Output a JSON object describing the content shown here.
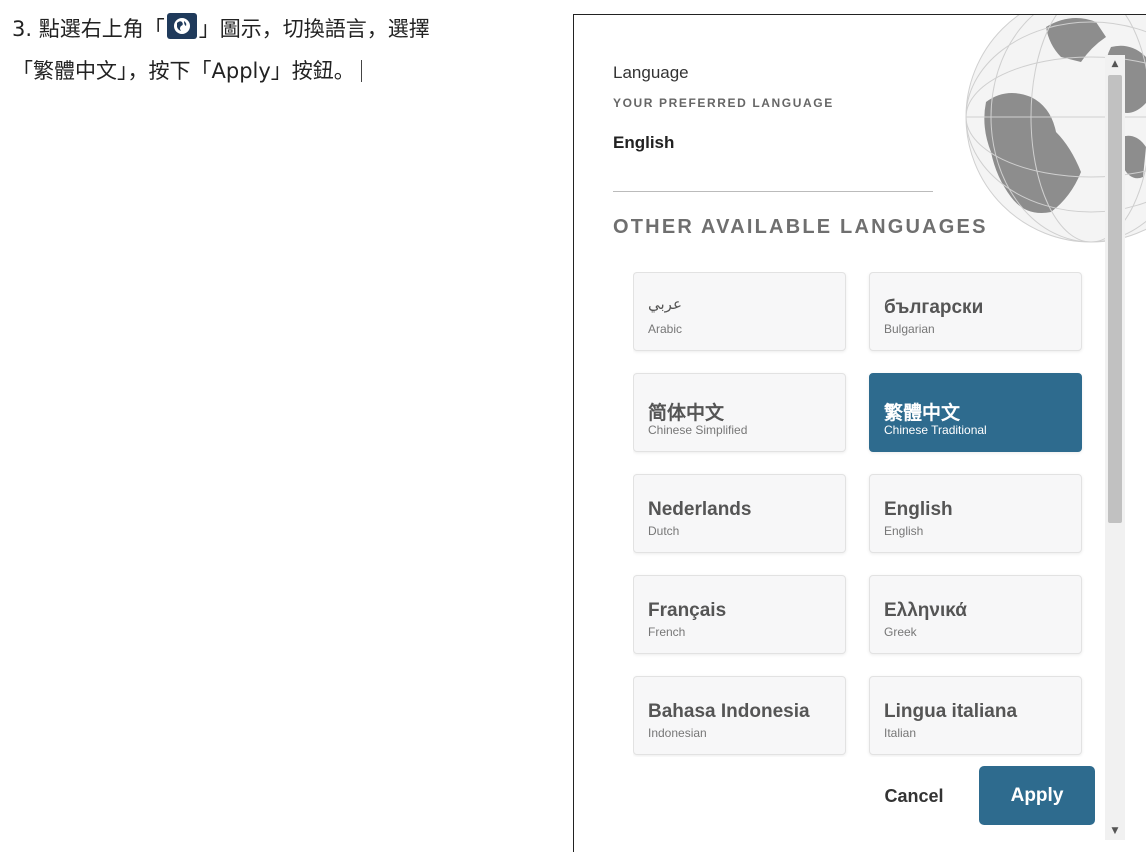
{
  "instruction": {
    "line1_before": "3. 點選右上角「",
    "line1_after": "」圖示，切換語言，選擇",
    "line2": "「繁體中文」，按下「Apply」按鈕。",
    "icon": "globe-icon"
  },
  "dialog": {
    "title": "Language",
    "preferred_label": "YOUR PREFERRED LANGUAGE",
    "current_language": "English",
    "other_heading": "OTHER AVAILABLE LANGUAGES",
    "languages": [
      {
        "native": "عربي",
        "english": "Arabic",
        "selected": false
      },
      {
        "native": "български",
        "english": "Bulgarian",
        "selected": false
      },
      {
        "native": "简体中文",
        "english": "Chinese Simplified",
        "selected": false
      },
      {
        "native": "繁體中文",
        "english": "Chinese Traditional",
        "selected": true
      },
      {
        "native": "Nederlands",
        "english": "Dutch",
        "selected": false
      },
      {
        "native": "English",
        "english": "English",
        "selected": false
      },
      {
        "native": "Français",
        "english": "French",
        "selected": false
      },
      {
        "native": "Ελληνικά",
        "english": "Greek",
        "selected": false
      },
      {
        "native": "Bahasa Indonesia",
        "english": "Indonesian",
        "selected": false
      },
      {
        "native": "Lingua italiana",
        "english": "Italian",
        "selected": false
      }
    ],
    "cancel_label": "Cancel",
    "apply_label": "Apply",
    "accent_color": "#2e6b8e"
  }
}
